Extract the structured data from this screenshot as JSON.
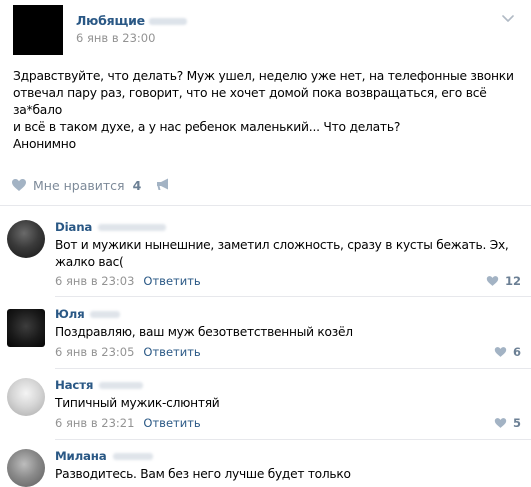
{
  "post": {
    "author": "Любящие",
    "date": "6 янв в 23:00",
    "text": "Здравствуйте, что делать? Муж ушел, неделю уже нет, на телефонные звонки\nотвечал пару раз, говорит, что не хочет домой пока возвращаться, его всё за*бало\nи всё в таком духе, а у нас ребенок маленький... Что делать?\nАнонимно",
    "like_label": "Мне нравится",
    "like_count": "4"
  },
  "comments": [
    {
      "author": "Diana",
      "text": "Вот и мужики нынешние, заметил сложность, сразу в кусты бежать. Эх,\nжалко вас(",
      "date": "6 янв в 23:03",
      "reply_label": "Ответить",
      "likes": "12"
    },
    {
      "author": "Юля",
      "text": "Поздравляю, ваш муж безответственный козёл",
      "date": "6 янв в 23:05",
      "reply_label": "Ответить",
      "likes": "6"
    },
    {
      "author": "Настя",
      "text": "Типичный мужик-слюнтяй",
      "date": "6 янв в 23:21",
      "reply_label": "Ответить",
      "likes": "5"
    },
    {
      "author": "Милана",
      "text": "Разводитесь. Вам без него лучше будет только",
      "date": "",
      "reply_label": "",
      "likes": ""
    }
  ],
  "colors": {
    "link": "#2a5885",
    "meta": "#939393",
    "like_icon": "#a3b3c4",
    "divider": "#e7e8ec"
  },
  "icons": {
    "more": "chevron-down-icon",
    "like": "heart-icon",
    "share": "megaphone-icon",
    "platform": "apple-icon"
  }
}
